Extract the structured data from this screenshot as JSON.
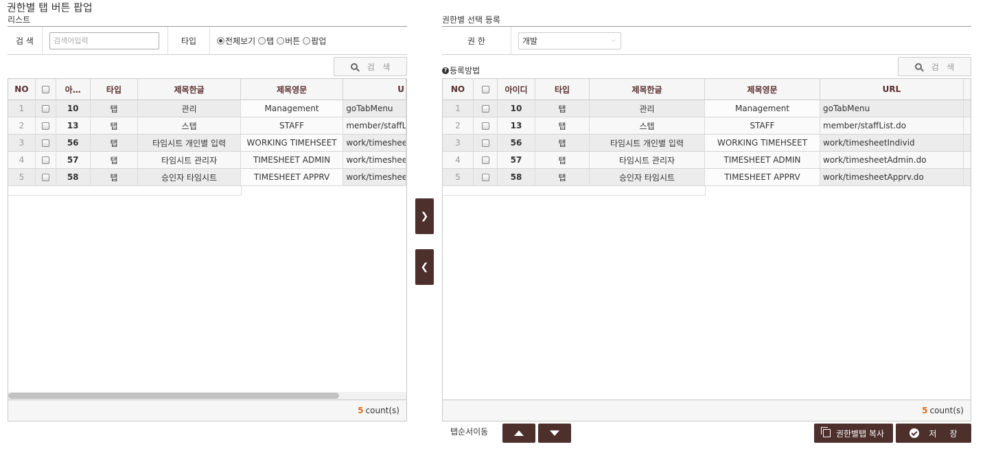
{
  "page_title": "권한별 탭 버튼 팝업",
  "left": {
    "section_title": "리스트",
    "search_label": "검 색",
    "search_placeholder": "검색어입력",
    "type_label": "타입",
    "radios": [
      {
        "label": "전체보기",
        "checked": true
      },
      {
        "label": "탭",
        "checked": false
      },
      {
        "label": "버튼",
        "checked": false
      },
      {
        "label": "팝업",
        "checked": false
      }
    ],
    "search_button": "검   색",
    "columns": [
      "NO",
      "",
      "아…",
      "타입",
      "제목한글",
      "제목영문",
      "U"
    ],
    "rows": [
      {
        "no": "1",
        "id": "10",
        "type": "탭",
        "title_ko": "관리",
        "title_en": "Management",
        "url": "goTabMenu"
      },
      {
        "no": "2",
        "id": "13",
        "type": "탭",
        "title_ko": "스텝",
        "title_en": "STAFF",
        "url": "member/staffList"
      },
      {
        "no": "3",
        "id": "56",
        "type": "탭",
        "title_ko": "타임시트 개인별 입력",
        "title_en": "WORKING TIMEHSEET",
        "url": "work/timesheetI"
      },
      {
        "no": "4",
        "id": "57",
        "type": "탭",
        "title_ko": "타임시트 관리자",
        "title_en": "TIMESHEET ADMIN",
        "url": "work/timesheetA"
      },
      {
        "no": "5",
        "id": "58",
        "type": "탭",
        "title_ko": "승인자 타임시트",
        "title_en": "TIMESHEET APPRV",
        "url": "work/timesheetA"
      }
    ],
    "count": "5",
    "count_suffix": "count(s)"
  },
  "right": {
    "section_title": "권한별 선택 등록",
    "auth_label": "권 한",
    "auth_value": "개발",
    "help_text": "등록방법",
    "search_button": "검   색",
    "columns": [
      "NO",
      "",
      "아이디",
      "타입",
      "제목한글",
      "제목영문",
      "URL"
    ],
    "rows": [
      {
        "no": "1",
        "id": "10",
        "type": "탭",
        "title_ko": "관리",
        "title_en": "Management",
        "url": "goTabMenu"
      },
      {
        "no": "2",
        "id": "13",
        "type": "탭",
        "title_ko": "스텝",
        "title_en": "STAFF",
        "url": "member/staffList.do"
      },
      {
        "no": "3",
        "id": "56",
        "type": "탭",
        "title_ko": "타임시트 개인별 입력",
        "title_en": "WORKING TIMEHSEET",
        "url": "work/timesheetIndivid"
      },
      {
        "no": "4",
        "id": "57",
        "type": "탭",
        "title_ko": "타임시트 관리자",
        "title_en": "TIMESHEET ADMIN",
        "url": "work/timesheetAdmin.do"
      },
      {
        "no": "5",
        "id": "58",
        "type": "탭",
        "title_ko": "승인자 타임시트",
        "title_en": "TIMESHEET APPRV",
        "url": "work/timesheetApprv.do"
      }
    ],
    "count": "5",
    "count_suffix": "count(s)"
  },
  "move_right_icon": "chevron-right-icon",
  "move_left_icon": "chevron-left-icon",
  "tab_order_label": "탭순서이동",
  "copy_button": "권한별탭 복사",
  "save_button": "저     장",
  "colors": {
    "accent_dark": "#4d2f2c",
    "count_orange": "#e06a1b",
    "header_text": "#5a2e2e"
  }
}
